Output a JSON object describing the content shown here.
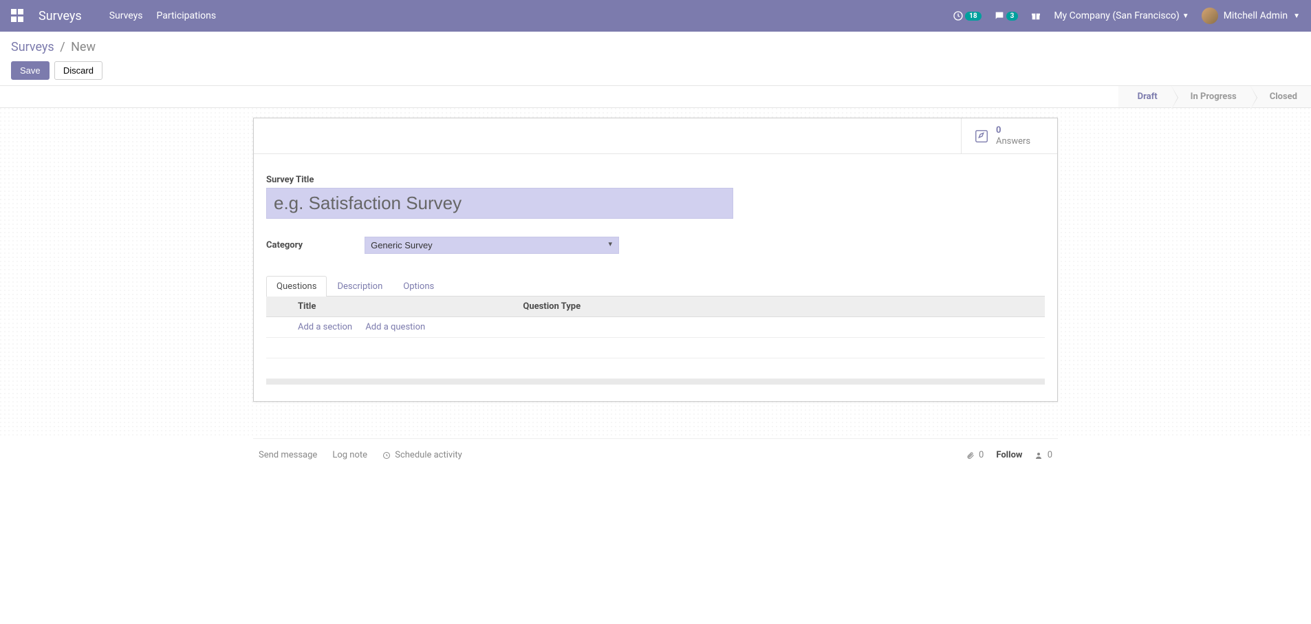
{
  "nav": {
    "app_title": "Surveys",
    "links": [
      "Surveys",
      "Participations"
    ],
    "clock_badge": "18",
    "chat_badge": "3",
    "company": "My Company (San Francisco)",
    "user": "Mitchell Admin"
  },
  "breadcrumb": {
    "root": "Surveys",
    "current": "New"
  },
  "buttons": {
    "save": "Save",
    "discard": "Discard"
  },
  "status": {
    "steps": [
      "Draft",
      "In Progress",
      "Closed"
    ],
    "active_index": 0
  },
  "statbox": {
    "count": "0",
    "label": "Answers"
  },
  "form": {
    "title_label": "Survey Title",
    "title_placeholder": "e.g. Satisfaction Survey",
    "category_label": "Category",
    "category_value": "Generic Survey"
  },
  "tabs": [
    "Questions",
    "Description",
    "Options"
  ],
  "table": {
    "col_title": "Title",
    "col_qtype": "Question Type",
    "add_section": "Add a section",
    "add_question": "Add a question"
  },
  "chatter": {
    "send": "Send message",
    "log": "Log note",
    "schedule": "Schedule activity",
    "attach_count": "0",
    "follow": "Follow",
    "follower_count": "0"
  }
}
